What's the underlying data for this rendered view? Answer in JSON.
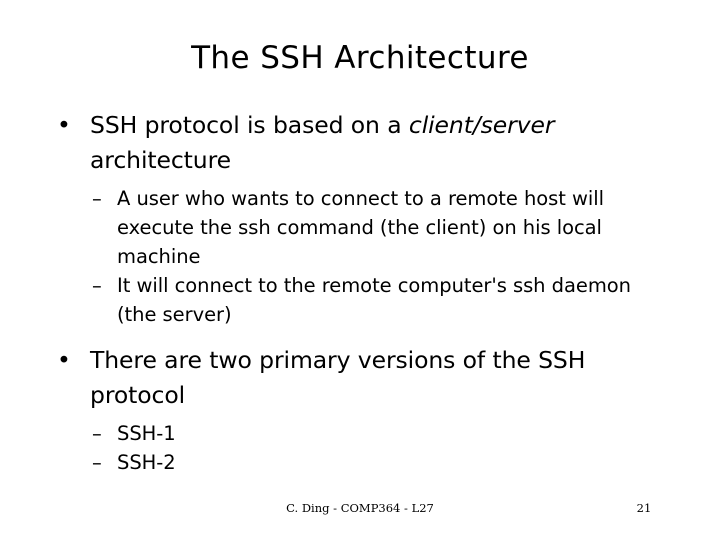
{
  "slide": {
    "title": "The SSH Architecture",
    "background_color": "#ffffff",
    "text_color": "#000000"
  },
  "content": {
    "blocks": [
      {
        "level1": {
          "marker": "•",
          "text_before_italic": "SSH protocol is based on a ",
          "italic_text": "client/server",
          "text_after_italic": " architecture"
        },
        "level2": [
          {
            "marker": "–",
            "text": "A user who wants to connect to a remote host will execute the ssh command (the client) on his local machine"
          },
          {
            "marker": "–",
            "text": "It will connect to the remote computer's ssh daemon (the server)"
          }
        ]
      },
      {
        "level1": {
          "marker": "•",
          "text": "There are two primary versions of the SSH protocol"
        },
        "level2": [
          {
            "marker": "–",
            "text": "SSH-1"
          },
          {
            "marker": "–",
            "text": "SSH-2"
          }
        ]
      }
    ]
  },
  "footer": {
    "credit": "C. Ding - COMP364 - L27",
    "page_number": "21"
  }
}
